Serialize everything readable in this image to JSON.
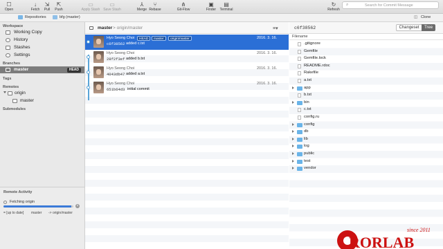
{
  "toolbar": {
    "buttons": [
      {
        "label": "Open",
        "icon": "open-icon",
        "glyph": "☐",
        "disabled": false
      },
      {
        "label": "Fetch",
        "icon": "fetch-icon",
        "glyph": "↓",
        "disabled": false
      },
      {
        "label": "Pull",
        "icon": "pull-icon",
        "glyph": "⇲",
        "disabled": false
      },
      {
        "label": "Push",
        "icon": "push-icon",
        "glyph": "⇱",
        "disabled": false
      },
      {
        "label": "Apply Stash",
        "icon": "apply-stash-icon",
        "glyph": "▭",
        "disabled": true
      },
      {
        "label": "Save Stash",
        "icon": "save-stash-icon",
        "glyph": "▭",
        "disabled": true
      },
      {
        "label": "Merge",
        "icon": "merge-icon",
        "glyph": "⅄",
        "disabled": false
      },
      {
        "label": "Rebase",
        "icon": "rebase-icon",
        "glyph": "⑂",
        "disabled": false
      },
      {
        "label": "Git-Flow",
        "icon": "git-flow-icon",
        "glyph": "⋔",
        "disabled": false
      },
      {
        "label": "Finder",
        "icon": "finder-icon",
        "glyph": "▣",
        "disabled": false
      },
      {
        "label": "Terminal",
        "icon": "terminal-icon",
        "glyph": "▤",
        "disabled": false
      },
      {
        "label": "Refresh",
        "icon": "refresh-icon",
        "glyph": "↻",
        "disabled": false
      }
    ],
    "search_placeholder": "Search for Commit Message"
  },
  "crumbbar": {
    "repositories": "Repositories",
    "repo_path": "bfg (master)",
    "clone": "Clone"
  },
  "sidebar": {
    "workspace_title": "Workspace",
    "workspace_items": [
      "Working Copy",
      "History",
      "Stashes",
      "Settings"
    ],
    "branches_title": "Branches",
    "branch_master": "master",
    "head_badge": "HEAD",
    "tags_title": "Tags",
    "remotes_title": "Remotes",
    "remote_origin": "origin",
    "remote_master": "master",
    "submodules_title": "Submodules"
  },
  "activity": {
    "title": "Remote Activity",
    "fetching": "Fetching origin",
    "progress": 0.97,
    "col1": "= [up to date]",
    "col2": "master",
    "col3": "-> origin/master"
  },
  "commit_list": {
    "branch": "master",
    "branch_path": "> origin/master",
    "commits": [
      {
        "author": "Hyo Seong Choi",
        "hash": "c6f38562",
        "message": "added c.txt",
        "date": "2016. 3. 16.",
        "tags": [
          "HEAD",
          "master",
          "origin/master"
        ],
        "selected": true
      },
      {
        "author": "Hyo Seong Choi",
        "hash": "28f2f3ef",
        "message": "added b.txt",
        "date": "2016. 3. 16.",
        "tags": [],
        "selected": false
      },
      {
        "author": "Hyo Seong Choi",
        "hash": "4043db47",
        "message": "added a.txt",
        "date": "2016. 3. 16.",
        "tags": [],
        "selected": false
      },
      {
        "author": "Hyo Seong Choi",
        "hash": "651b64d3",
        "message": "initial commit",
        "date": "2016. 3. 16.",
        "tags": [],
        "selected": false
      }
    ]
  },
  "file_panel": {
    "hash": "c6f38562",
    "changeset_label": "Changeset",
    "tree_label": "Tree",
    "column_header": "Filename",
    "files": [
      {
        "name": ".gitignore",
        "dir": false
      },
      {
        "name": "Gemfile",
        "dir": false
      },
      {
        "name": "Gemfile.lock",
        "dir": false
      },
      {
        "name": "README.rdoc",
        "dir": false
      },
      {
        "name": "Rakefile",
        "dir": false
      },
      {
        "name": "a.txt",
        "dir": false
      },
      {
        "name": "app",
        "dir": true
      },
      {
        "name": "b.txt",
        "dir": false
      },
      {
        "name": "bin",
        "dir": true
      },
      {
        "name": "c.txt",
        "dir": false
      },
      {
        "name": "config.ru",
        "dir": false
      },
      {
        "name": "config",
        "dir": true
      },
      {
        "name": "db",
        "dir": true
      },
      {
        "name": "lib",
        "dir": true
      },
      {
        "name": "log",
        "dir": true
      },
      {
        "name": "public",
        "dir": true
      },
      {
        "name": "test",
        "dir": true
      },
      {
        "name": "vendor",
        "dir": true
      }
    ]
  },
  "watermark": {
    "text": "RORLAB",
    "since": "since 2011",
    "color": "#cc1111"
  }
}
